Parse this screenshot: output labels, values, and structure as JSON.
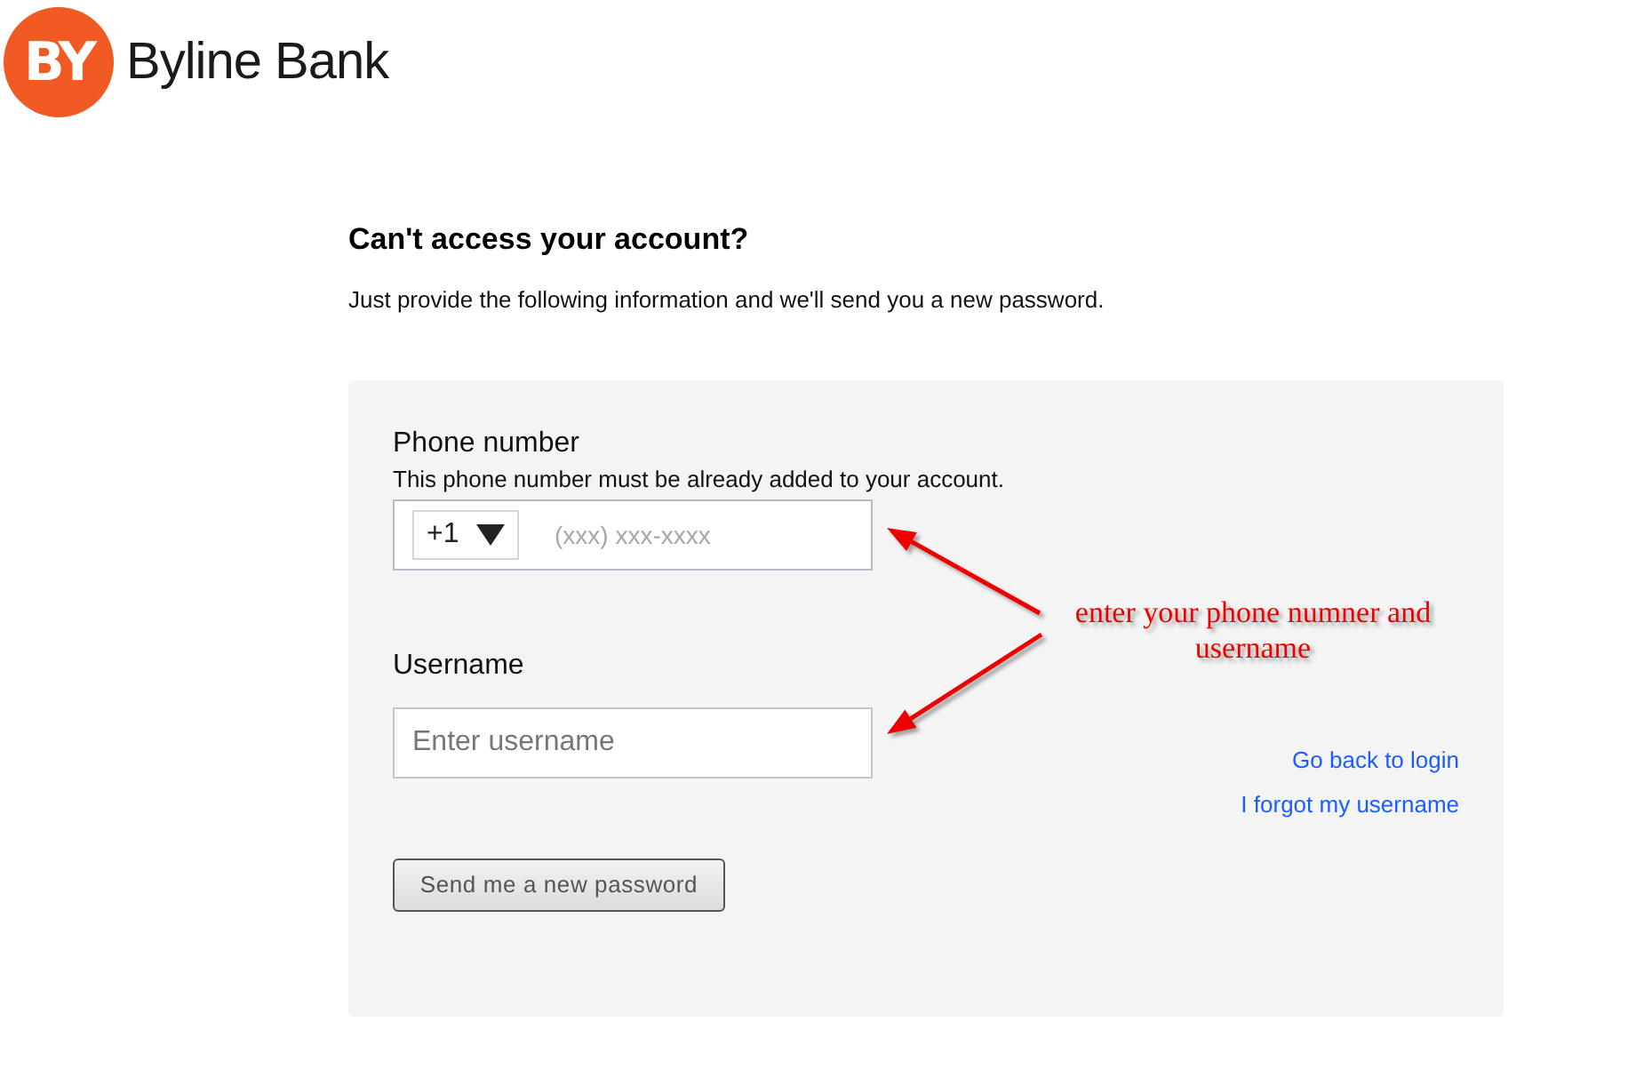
{
  "logo": {
    "mark": "BY",
    "name": "Byline Bank"
  },
  "heading": "Can't access your account?",
  "intro": "Just provide the following information and we'll send you a new password.",
  "form": {
    "fields": [
      {
        "kind": "phone",
        "label": "Phone number",
        "hint": "This phone number must be already added to your account.",
        "country_code": "+1",
        "placeholder": "(xxx) xxx-xxxx"
      },
      {
        "kind": "text",
        "label": "Username",
        "placeholder": "Enter username"
      }
    ],
    "links": [
      "Go back to login",
      "I forgot my username"
    ],
    "submit": "Send me a new password"
  },
  "annotation": {
    "text": "enter your phone numner and username"
  }
}
